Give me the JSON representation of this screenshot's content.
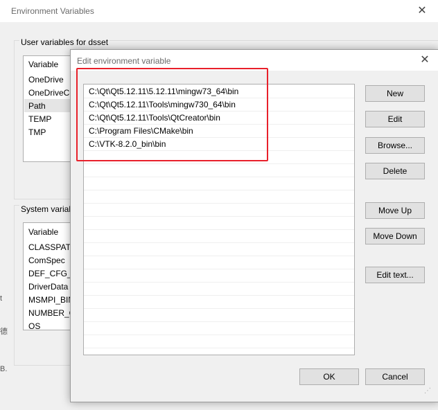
{
  "background_window": {
    "title": "Environment Variables",
    "user_group_label": "User variables for dsset",
    "user_list": {
      "header": "Variable",
      "items": [
        "OneDrive",
        "OneDriveCo",
        "Path",
        "TEMP",
        "TMP"
      ]
    },
    "system_group_label": "System variab",
    "system_list": {
      "header": "Variable",
      "items": [
        "CLASSPATH",
        "ComSpec",
        "DEF_CFG_D",
        "DriverData",
        "MSMPI_BIN",
        "NUMBER_O",
        "OS"
      ]
    },
    "left_edge_marks": [
      "t",
      "德",
      "B."
    ]
  },
  "dialog": {
    "title": "Edit environment variable",
    "path_entries": [
      "C:\\Qt\\Qt5.12.11\\5.12.11\\mingw73_64\\bin",
      "C:\\Qt\\Qt5.12.11\\Tools\\mingw730_64\\bin",
      "C:\\Qt\\Qt5.12.11\\Tools\\QtCreator\\bin",
      "C:\\Program Files\\CMake\\bin",
      "C:\\VTK-8.2.0_bin\\bin"
    ],
    "buttons": {
      "new": "New",
      "edit": "Edit",
      "browse": "Browse...",
      "delete": "Delete",
      "move_up": "Move Up",
      "move_down": "Move Down",
      "edit_text": "Edit text...",
      "ok": "OK",
      "cancel": "Cancel"
    }
  },
  "icons": {
    "close": "close-icon",
    "resize_grip": "resize-grip-icon"
  },
  "colors": {
    "highlight_annotation": "#e8202a",
    "selected_row": "#e5e5e5"
  }
}
